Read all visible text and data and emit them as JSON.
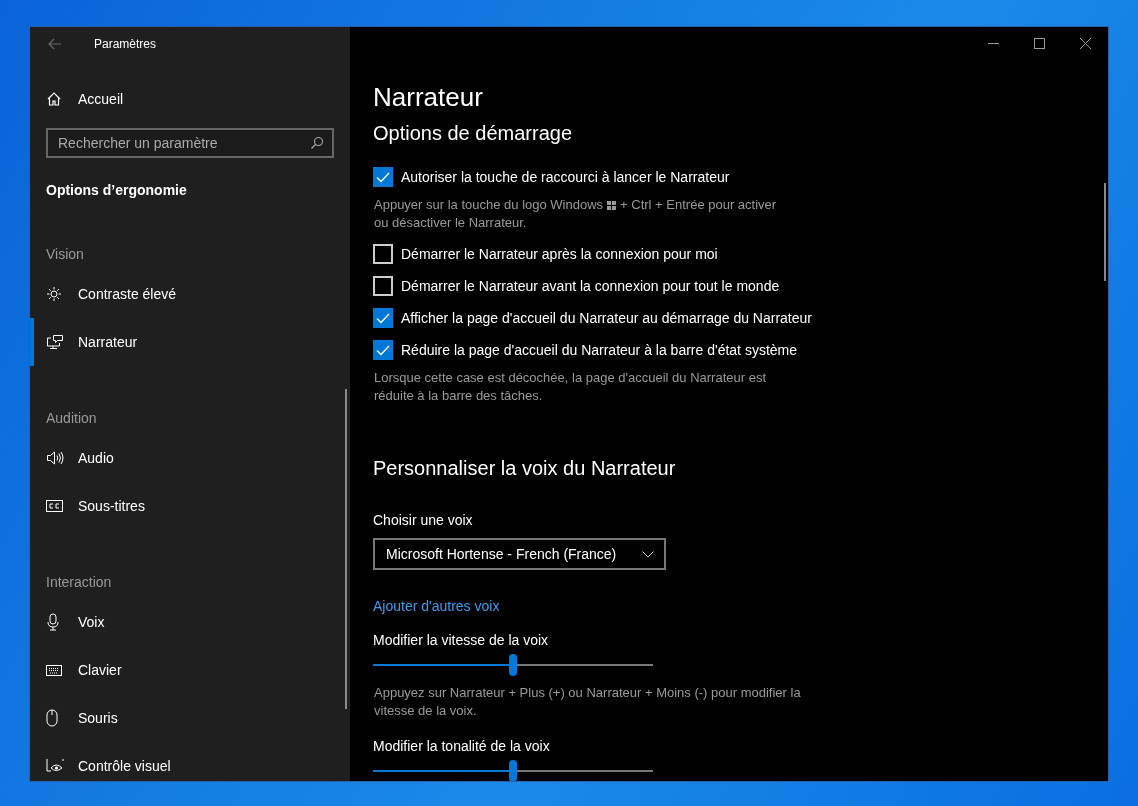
{
  "window": {
    "title": "Paramètres"
  },
  "sidebar": {
    "home": "Accueil",
    "search": {
      "placeholder": "Rechercher un paramètre"
    },
    "heading": "Options d’ergonomie",
    "groups": [
      {
        "label": "Vision",
        "items": [
          {
            "label": "Contraste élevé",
            "kind": "sun",
            "selected": false
          },
          {
            "label": "Narrateur",
            "kind": "narrator",
            "selected": true
          }
        ]
      },
      {
        "label": "Audition",
        "items": [
          {
            "label": "Audio",
            "kind": "speaker",
            "selected": false
          },
          {
            "label": "Sous-titres",
            "kind": "captions",
            "selected": false
          }
        ]
      },
      {
        "label": "Interaction",
        "items": [
          {
            "label": "Voix",
            "kind": "microphone",
            "selected": false
          },
          {
            "label": "Clavier",
            "kind": "keyboard",
            "selected": false
          },
          {
            "label": "Souris",
            "kind": "mouse",
            "selected": false
          },
          {
            "label": "Contrôle visuel",
            "kind": "eye",
            "selected": false
          }
        ]
      }
    ]
  },
  "page": {
    "title": "Narrateur",
    "startup": {
      "heading": "Options de démarrage",
      "options": [
        {
          "label": "Autoriser la touche de raccourci à lancer le Narrateur",
          "checked": true,
          "hint": [
            [
              {
                "kind": "text",
                "text": "Appuyer sur la touche du logo Windows"
              },
              {
                "kind": "windows-logo"
              },
              {
                "kind": "text",
                "text": "+ Ctrl + Entrée pour activer"
              }
            ],
            [
              {
                "kind": "text",
                "text": "ou désactiver le Narrateur."
              }
            ]
          ]
        },
        {
          "label": "Démarrer le Narrateur après la connexion pour moi",
          "checked": false
        },
        {
          "label": "Démarrer le Narrateur avant la connexion pour tout le monde",
          "checked": false
        },
        {
          "label": "Afficher la page d'accueil du Narrateur au démarrage du Narrateur",
          "checked": true
        },
        {
          "label": "Réduire la page d'accueil du Narrateur à la barre d'état système",
          "checked": true,
          "hint": [
            [
              {
                "kind": "text",
                "text": "Lorsque cette case est décochée, la page d'accueil du Narrateur est"
              }
            ],
            [
              {
                "kind": "text",
                "text": "réduite à la barre des tâches."
              }
            ]
          ]
        }
      ]
    },
    "voice": {
      "heading": "Personnaliser la voix du Narrateur",
      "choose_label": "Choisir une voix",
      "voice_value": "Microsoft Hortense - French (France)",
      "link": "Ajouter d'autres voix",
      "sliders": [
        {
          "label": "Modifier la vitesse de la voix",
          "level": 0.5,
          "hint": "Appuyez sur Narrateur + Plus (+) ou Narrateur + Moins (-) pour modifier la vitesse de la voix."
        },
        {
          "label": "Modifier la tonalité de la voix",
          "level": 0.5
        }
      ]
    }
  }
}
